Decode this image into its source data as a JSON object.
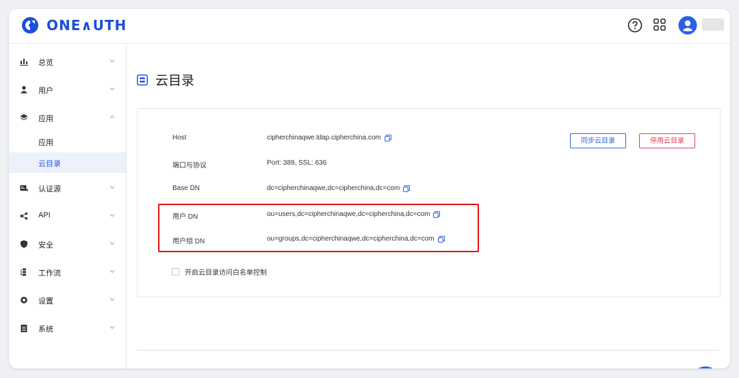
{
  "app": {
    "brand": "ONE∧UTH"
  },
  "header": {
    "help_icon": "question-circle-icon",
    "apps_icon": "grid-icon",
    "user_icon": "user-avatar-icon"
  },
  "sidebar": {
    "items": [
      {
        "label": "总览",
        "icon": "bar-chart-icon"
      },
      {
        "label": "用户",
        "icon": "user-icon"
      },
      {
        "label": "应用",
        "icon": "layers-icon"
      },
      {
        "label": "应用",
        "icon": ""
      },
      {
        "label": "云目录",
        "icon": ""
      },
      {
        "label": "认证源",
        "icon": "id-card-icon"
      },
      {
        "label": "API",
        "icon": "share-nodes-icon"
      },
      {
        "label": "安全",
        "icon": "shield-icon"
      },
      {
        "label": "工作流",
        "icon": "workflow-icon"
      },
      {
        "label": "设置",
        "icon": "gear-icon"
      },
      {
        "label": "系统",
        "icon": "clipboard-icon"
      }
    ]
  },
  "page": {
    "title": "云目录"
  },
  "details": [
    {
      "key": "Host",
      "value": "cipherchinaqwe.ldap.cipherchina.com"
    },
    {
      "key": "端口与协议",
      "value": "Port: 389, SSL: 636"
    },
    {
      "key": "Base DN",
      "value": "dc=cipherchinaqwe,dc=cipherchina,dc=com"
    },
    {
      "key": "用户 DN",
      "value": "ou=users,dc=cipherchinaqwe,dc=cipherchina,dc=com"
    },
    {
      "key": "用户组 DN",
      "value": "ou=groups,dc=cipherchinaqwe,dc=cipherchina,dc=com"
    }
  ],
  "actions": {
    "sync_label": "同步云目录",
    "stop_label": "停用云目录"
  },
  "whitelist": {
    "label": "开启云目录访问白名单控制",
    "checked": false
  },
  "colors": {
    "accent": "#2357e5",
    "danger": "#e0404a",
    "highlight": "#e01010"
  }
}
